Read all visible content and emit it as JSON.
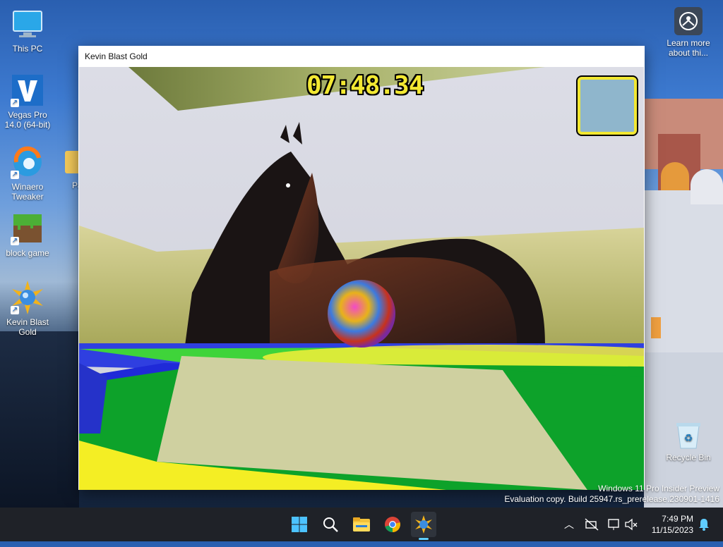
{
  "desktop": {
    "icons": [
      {
        "id": "this-pc",
        "label": "This PC"
      },
      {
        "id": "vegas",
        "label": "Vegas Pro\n14.0 (64-bit)"
      },
      {
        "id": "winaero",
        "label": "Winaero\nTweaker"
      },
      {
        "id": "partial",
        "label": "Pa"
      },
      {
        "id": "block-game",
        "label": "block game"
      },
      {
        "id": "kevin",
        "label": "Kevin Blast\nGold"
      }
    ],
    "learn_more": "Learn more\nabout thi...",
    "recycle_bin": "Recycle Bin"
  },
  "window": {
    "title": "Kevin Blast Gold",
    "timer": "07:48.34"
  },
  "watermark": {
    "line1": "Windows 11 Pro Insider Preview",
    "line2": "Evaluation copy. Build 25947.rs_prerelease.230901-1416"
  },
  "taskbar": {
    "apps": [
      "start",
      "search",
      "file-explorer",
      "chrome",
      "kevin-blast-gold"
    ],
    "time": "7:49 PM",
    "date": "11/15/2023"
  },
  "colors": {
    "timer_yellow": "#f2e832",
    "taskbar": "#1f2228",
    "accent": "#60cdff"
  }
}
